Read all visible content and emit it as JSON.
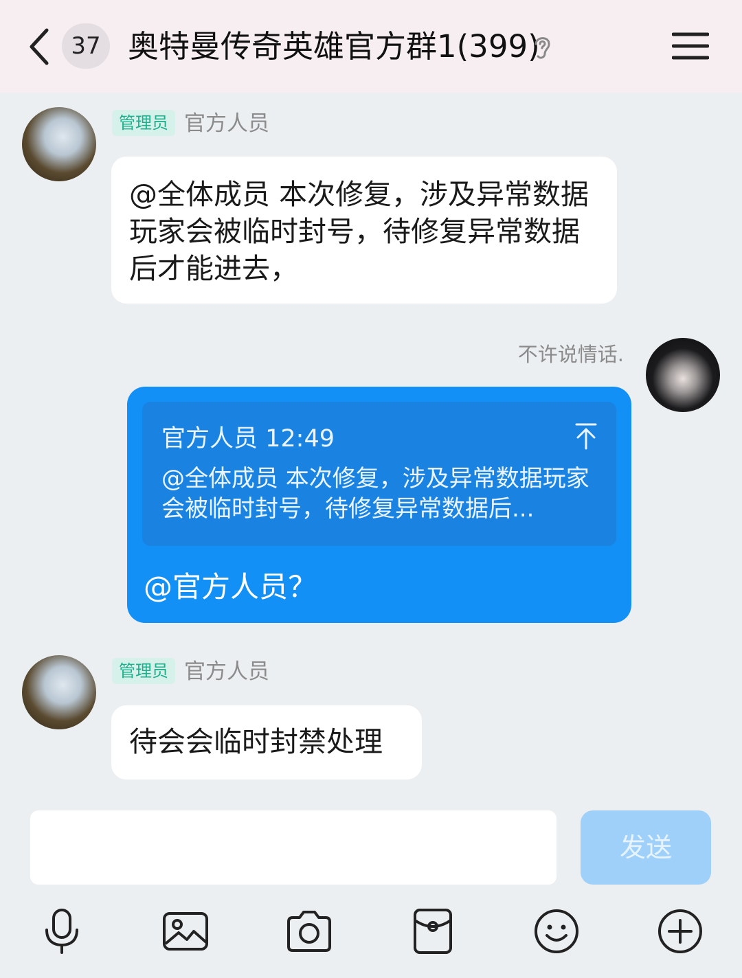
{
  "header": {
    "unread_count": "37",
    "title": "奥特曼传奇英雄官方群1(399)",
    "icons": [
      "back-chevron-icon",
      "ear-icon",
      "menu-icon"
    ]
  },
  "messages": [
    {
      "role_tag": "管理员",
      "sender": "官方人员",
      "text": "@全体成员 本次修复，涉及异常数据玩家会被临时封号，待修复异常数据后才能进去，"
    },
    {
      "sender": "不许说情话.",
      "quote": {
        "header": "官方人员 12:49",
        "text": "@全体成员 本次修复，涉及异常数据玩家会被临时封号，待修复异常数据后..."
      },
      "text": "@官方人员？"
    },
    {
      "role_tag": "管理员",
      "sender": "官方人员",
      "text": "待会会临时封禁处理"
    }
  ],
  "composer": {
    "input_value": "",
    "send_label": "发送"
  },
  "toolbar": [
    "microphone-icon",
    "image-icon",
    "camera-icon",
    "red-packet-icon",
    "emoji-icon",
    "plus-icon"
  ],
  "colors": {
    "header_bg": "#f7eef2",
    "chat_bg": "#eceff1",
    "blue_bubble": "#1290f5",
    "send_button": "#9ed0f9",
    "admin_tag_bg": "#d6f1ea",
    "admin_tag_text": "#1fae8c"
  }
}
